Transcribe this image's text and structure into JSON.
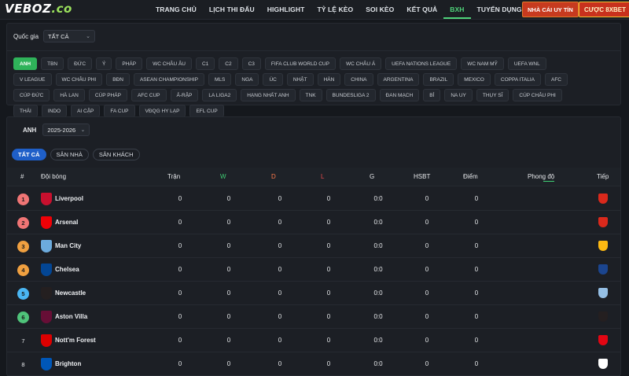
{
  "brand": {
    "logo_main": "VEBOZ",
    "logo_suffix": ".co"
  },
  "nav": {
    "items": [
      "TRANG CHỦ",
      "LỊCH THI ĐẤU",
      "HIGHLIGHT",
      "TỶ LỆ KÈO",
      "SOI KÈO",
      "KẾT QUẢ",
      "BXH",
      "TUYỂN DỤNG"
    ],
    "active": "BXH",
    "nhacai_button": "NHÀ CÁI UY TÍN",
    "cuoc_button": "CƯỢC 8XBET"
  },
  "filters": {
    "country_label": "Quốc gia",
    "country_value": "TẤT CẢ",
    "leagues": [
      "ANH",
      "TBN",
      "ĐỨC",
      "Ý",
      "PHÁP",
      "WC CHÂU ÂU",
      "C1",
      "C2",
      "C3",
      "FIFA CLUB WORLD CUP",
      "WC CHÂU Á",
      "UEFA NATIONS LEAGUE",
      "WC NAM MỸ",
      "UEFA WNL",
      "V LEAGUE",
      "WC CHÂU PHI",
      "BĐN",
      "ASEAN CHAMPIONSHIP",
      "MLS",
      "NGA",
      "ÚC",
      "NHẬT",
      "HÀN",
      "CHINA",
      "ARGENTINA",
      "BRAZIL",
      "MEXICO",
      "COPPA ITALIA",
      "AFC",
      "CÚP ĐỨC",
      "HÀ LAN",
      "CÚP PHÁP",
      "AFC CUP",
      "Ả-RẬP",
      "LA LIGA2",
      "HẠNG NHẤT ANH",
      "TNK",
      "BUNDESLIGA 2",
      "ĐAN MẠCH",
      "BỈ",
      "NA UY",
      "THỤY SĨ",
      "CÚP CHÂU PHI",
      "THÁI",
      "INDO",
      "AI CẬP",
      "FA CUP",
      "VĐQG HY LẠP",
      "EFL CUP"
    ],
    "active_league": "ANH"
  },
  "standings": {
    "league_label": "ANH",
    "season_value": "2025-2026",
    "tabs": [
      "TẤT CẢ",
      "SÂN NHÀ",
      "SÂN KHÁCH"
    ],
    "active_tab": "TẤT CẢ",
    "headers": {
      "rank": "#",
      "team": "Đội bóng",
      "played": "Trận",
      "w": "W",
      "d": "D",
      "l": "L",
      "g": "G",
      "hsbt": "HSBT",
      "points": "Điểm",
      "form": "Phong độ",
      "next": "Tiếp"
    },
    "rows": [
      {
        "rank": "1",
        "team": "Liverpool",
        "played": "0",
        "w": "0",
        "d": "0",
        "l": "0",
        "g": "0:0",
        "hsbt": "0",
        "points": "0"
      },
      {
        "rank": "2",
        "team": "Arsenal",
        "played": "0",
        "w": "0",
        "d": "0",
        "l": "0",
        "g": "0:0",
        "hsbt": "0",
        "points": "0"
      },
      {
        "rank": "3",
        "team": "Man City",
        "played": "0",
        "w": "0",
        "d": "0",
        "l": "0",
        "g": "0:0",
        "hsbt": "0",
        "points": "0"
      },
      {
        "rank": "4",
        "team": "Chelsea",
        "played": "0",
        "w": "0",
        "d": "0",
        "l": "0",
        "g": "0:0",
        "hsbt": "0",
        "points": "0"
      },
      {
        "rank": "5",
        "team": "Newcastle",
        "played": "0",
        "w": "0",
        "d": "0",
        "l": "0",
        "g": "0:0",
        "hsbt": "0",
        "points": "0"
      },
      {
        "rank": "6",
        "team": "Aston Villa",
        "played": "0",
        "w": "0",
        "d": "0",
        "l": "0",
        "g": "0:0",
        "hsbt": "0",
        "points": "0"
      },
      {
        "rank": "7",
        "team": "Nott'm Forest",
        "played": "0",
        "w": "0",
        "d": "0",
        "l": "0",
        "g": "0:0",
        "hsbt": "0",
        "points": "0"
      },
      {
        "rank": "8",
        "team": "Brighton",
        "played": "0",
        "w": "0",
        "d": "0",
        "l": "0",
        "g": "0:0",
        "hsbt": "0",
        "points": "0"
      }
    ]
  },
  "colors": {
    "accent_green": "#2fb35a",
    "tab_blue": "#1f5fc8",
    "rank_red": "#f07575",
    "rank_orange": "#f0a040",
    "rank_blue": "#4ab6f3",
    "rank_green": "#4fc37a"
  },
  "icons": {
    "team_crests": [
      "liverpool-crest-icon",
      "arsenal-crest-icon",
      "man-city-crest-icon",
      "chelsea-crest-icon",
      "newcastle-crest-icon",
      "aston-villa-crest-icon",
      "nottm-forest-crest-icon",
      "brighton-crest-icon"
    ],
    "next_opponents": [
      "bournemouth-crest-icon",
      "man-utd-crest-icon",
      "wolves-crest-icon",
      "crystal-palace-crest-icon",
      "aston-villa-crest-icon",
      "newcastle-crest-icon",
      "brentford-crest-icon",
      "fulham-crest-icon"
    ]
  }
}
